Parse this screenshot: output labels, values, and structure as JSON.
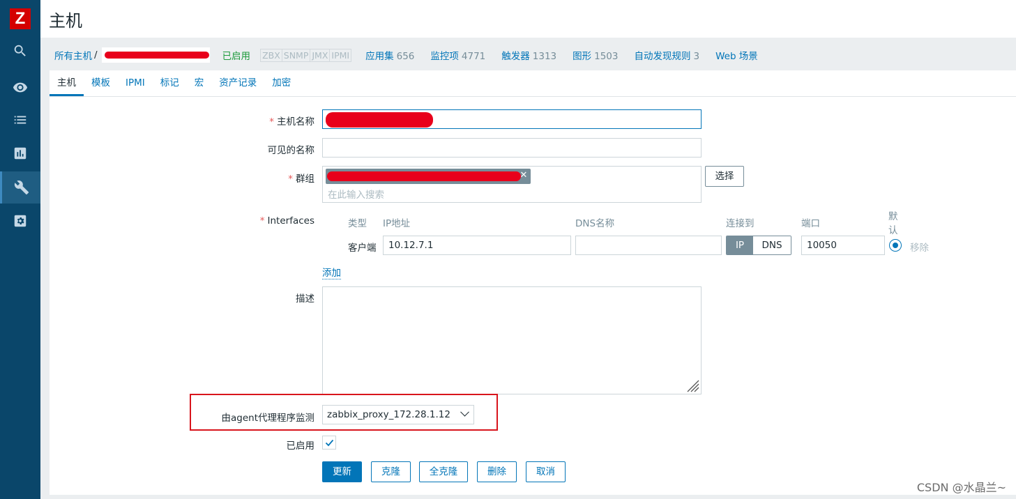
{
  "sidebar": {
    "logo": "Z",
    "items": [
      {
        "icon": "search-icon",
        "active": false
      },
      {
        "icon": "eye-icon",
        "active": false
      },
      {
        "icon": "list-icon",
        "active": false
      },
      {
        "icon": "reports-icon",
        "active": false
      },
      {
        "icon": "wrench-icon",
        "active": true
      },
      {
        "icon": "gear-icon",
        "active": false
      }
    ]
  },
  "header": {
    "title": "主机"
  },
  "breadcrumb": {
    "all_hosts": "所有主机",
    "separator": "/",
    "enabled": "已启用",
    "availability": [
      "ZBX",
      "SNMP",
      "JMX",
      "IPMI"
    ],
    "links": [
      {
        "label": "应用集",
        "count": "656"
      },
      {
        "label": "监控项",
        "count": "4771"
      },
      {
        "label": "触发器",
        "count": "1313"
      },
      {
        "label": "图形",
        "count": "1503"
      },
      {
        "label": "自动发现规则",
        "count": "3"
      },
      {
        "label": "Web 场景",
        "count": ""
      }
    ]
  },
  "tabs": [
    "主机",
    "模板",
    "IPMI",
    "标记",
    "宏",
    "资产记录",
    "加密"
  ],
  "form": {
    "required_mark": "*",
    "host_name_label": "主机名称",
    "visible_name_label": "可见的名称",
    "groups_label": "群组",
    "groups_placeholder": "在此输入搜索",
    "select_button": "选择",
    "interfaces_label": "Interfaces",
    "iface_headers": {
      "type": "类型",
      "ip": "IP地址",
      "dns": "DNS名称",
      "connect": "连接到",
      "port": "端口",
      "default_line1": "默",
      "default_line2": "认"
    },
    "iface_row": {
      "type": "客户端",
      "ip": "10.12.7.1",
      "dns": "",
      "connect_ip": "IP",
      "connect_dns": "DNS",
      "port": "10050",
      "remove": "移除"
    },
    "add_link": "添加",
    "description_label": "描述",
    "proxy_label": "由agent代理程序监测",
    "proxy_value": "zabbix_proxy_172.28.1.12",
    "enabled_label": "已启用",
    "buttons": {
      "update": "更新",
      "clone": "克隆",
      "full_clone": "全克隆",
      "delete": "删除",
      "cancel": "取消"
    }
  },
  "watermark": "CSDN @水晶兰~",
  "colors": {
    "sidebar": "#0a466a",
    "link": "#0275b8",
    "enabled": "#1e9b3c",
    "highlight": "#d8141c",
    "redaction": "#e8001b"
  }
}
